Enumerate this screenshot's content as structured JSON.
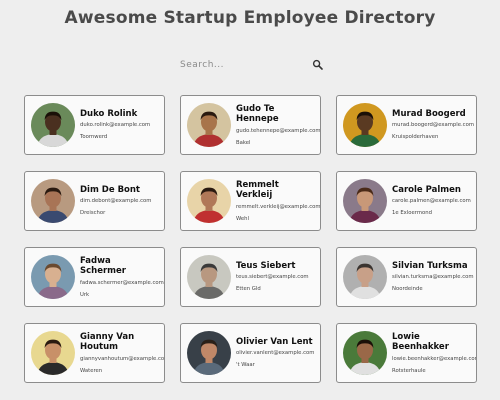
{
  "page": {
    "title": "Awesome Startup Employee Directory"
  },
  "search": {
    "placeholder": "Search..."
  },
  "employees": [
    {
      "name": "Duko Rolink",
      "email": "duko.rolink@example.com",
      "city": "Toornwerd",
      "bg": "#6a8a5a",
      "skin": "#4a3020",
      "hair": "#1a1008",
      "shirt": "#d8d8d8"
    },
    {
      "name": "Gudo Te Hennepe",
      "email": "gudo.tehennepe@example.com",
      "city": "Bakel",
      "bg": "#d4c4a0",
      "skin": "#a8744a",
      "hair": "#2a1a10",
      "shirt": "#b03030"
    },
    {
      "name": "Murad Boogerd",
      "email": "murad.boogerd@example.com",
      "city": "Kruispolderhaven",
      "bg": "#d09820",
      "skin": "#5a3a22",
      "hair": "#1a1008",
      "shirt": "#2a6a3a"
    },
    {
      "name": "Dim De Bont",
      "email": "dim.debont@example.com",
      "city": "Dreischor",
      "bg": "#b89a80",
      "skin": "#a87456",
      "hair": "#2a1a10",
      "shirt": "#3a4a70"
    },
    {
      "name": "Remmelt Verkleij",
      "email": "remmelt.verkleij@example.com",
      "city": "Wehl",
      "bg": "#e8d4a8",
      "skin": "#b07858",
      "hair": "#2a1a10",
      "shirt": "#c03030"
    },
    {
      "name": "Carole Palmen",
      "email": "carole.palmen@example.com",
      "city": "1e Exloermond",
      "bg": "#8a7a8a",
      "skin": "#c89878",
      "hair": "#4a2a18",
      "shirt": "#6a2a4a"
    },
    {
      "name": "Fadwa Schermer",
      "email": "fadwa.schermer@example.com",
      "city": "Urk",
      "bg": "#7a9ab0",
      "skin": "#d8b090",
      "hair": "#6a4a30",
      "shirt": "#8a6a8a"
    },
    {
      "name": "Teus Siebert",
      "email": "teus.siebert@example.com",
      "city": "Etten Gld",
      "bg": "#c8c8c0",
      "skin": "#b89880",
      "hair": "#3a3a3a",
      "shirt": "#6a6a68"
    },
    {
      "name": "Silvian Turksma",
      "email": "silvian.turksma@example.com",
      "city": "Noordeinde",
      "bg": "#b0b0b0",
      "skin": "#c8a088",
      "hair": "#3a3430",
      "shirt": "#e0e0e0"
    },
    {
      "name": "Gianny Van Houtum",
      "email": "giannyvanhoutum@example.com",
      "city": "Wateren",
      "bg": "#e8d890",
      "skin": "#c89068",
      "hair": "#2a1a10",
      "shirt": "#2a2a2a"
    },
    {
      "name": "Olivier Van Lent",
      "email": "olivier.vanlent@example.com",
      "city": "'t Waar",
      "bg": "#384048",
      "skin": "#c08868",
      "hair": "#2a2018",
      "shirt": "#5a6a7a"
    },
    {
      "name": "Lowie Beenhakker",
      "email": "lowie.beenhakker@example.com",
      "city": "Rotsterhaule",
      "bg": "#4a7a3a",
      "skin": "#9a6848",
      "hair": "#1a1008",
      "shirt": "#e0e0e0"
    }
  ]
}
